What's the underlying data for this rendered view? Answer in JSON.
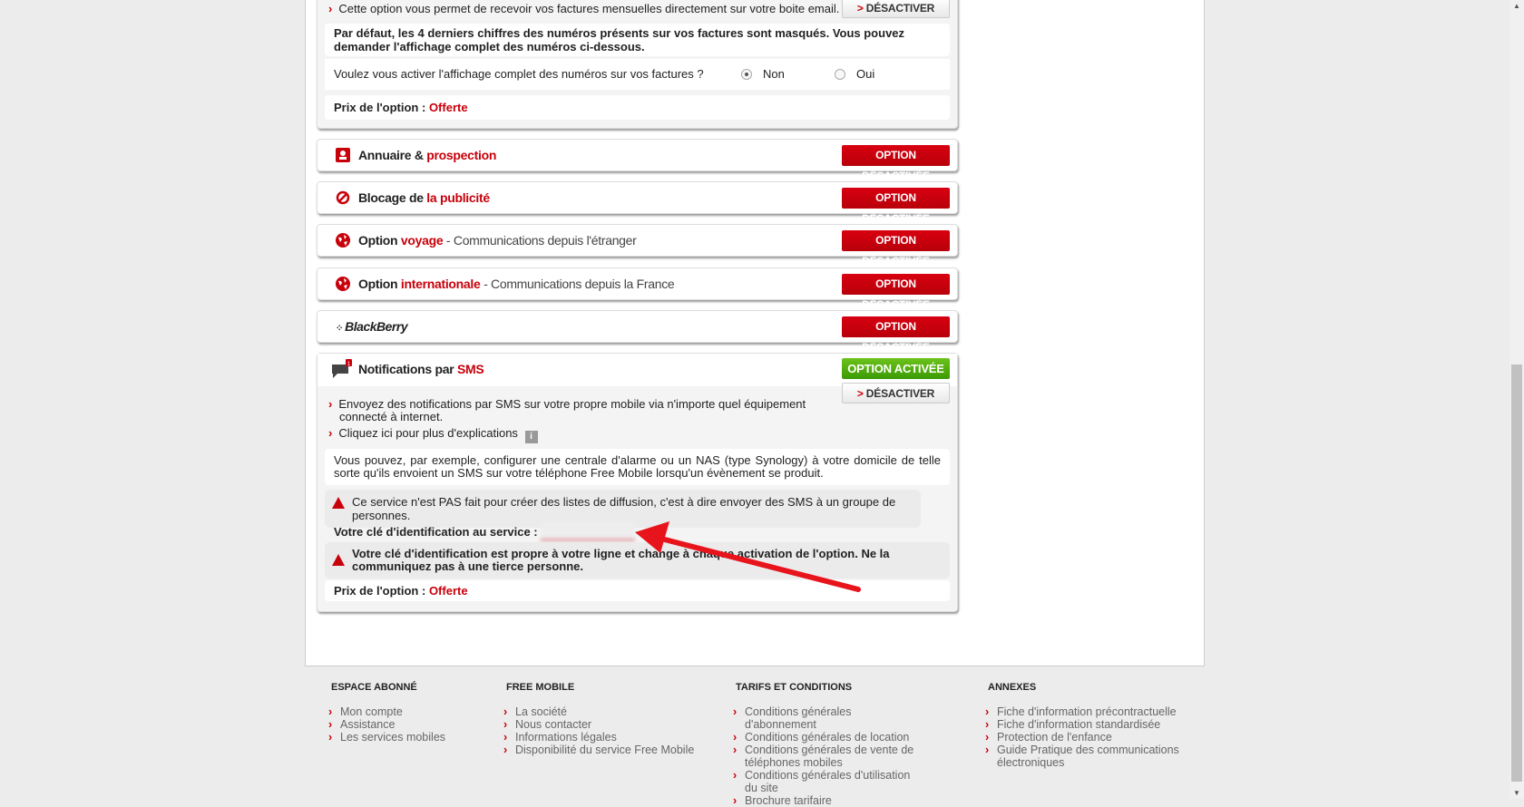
{
  "colors": {
    "accent": "#c8000a",
    "active": "#4caf10"
  },
  "top_card": {
    "bullet": "Cette option vous permet de recevoir vos factures mensuelles directement sur votre boite email.",
    "deactivate": "DÉSACTIVER",
    "note": "Par défaut, les 4 derniers chiffres des numéros présents sur vos factures sont masqués. Vous pouvez demander l'affichage complet des numéros ci-dessous.",
    "question": "Voulez vous activer l'affichage complet des numéros sur vos factures ?",
    "options": [
      {
        "label": "Non",
        "selected": true
      },
      {
        "label": "Oui",
        "selected": false
      }
    ],
    "price_label": "Prix de l'option : ",
    "price": "Offerte"
  },
  "options": [
    {
      "icon": "directory-icon",
      "title": "Annuaire & ",
      "highlight": "prospection",
      "sub": "",
      "status": "OPTION DÉSACTIVÉE"
    },
    {
      "icon": "block-icon",
      "title": "Blocage de ",
      "highlight": "la publicité",
      "sub": "",
      "status": "OPTION DÉSACTIVÉE"
    },
    {
      "icon": "globe-icon",
      "title": "Option ",
      "highlight": "voyage",
      "sub": " - Communications depuis l'étranger",
      "status": "OPTION DÉSACTIVÉE"
    },
    {
      "icon": "globe-icon",
      "title": "Option ",
      "highlight": "internationale",
      "sub": " - Communications depuis la France",
      "status": "OPTION DÉSACTIVÉE"
    },
    {
      "icon": "blackberry-logo",
      "title": "BlackBerry",
      "highlight": "",
      "sub": "",
      "status": "OPTION DÉSACTIVÉE"
    }
  ],
  "sms": {
    "title": "Notifications par ",
    "highlight": "SMS",
    "badge": "1",
    "status": "OPTION ACTIVÉE",
    "deactivate": "DÉSACTIVER",
    "bullets": [
      "Envoyez des notifications par SMS sur votre propre mobile via n'importe quel équipement connecté à internet.",
      "Cliquez ici pour plus d'explications"
    ],
    "example": "Vous pouvez, par exemple, configurer une centrale d'alarme ou un NAS (type Synology) à votre domicile de telle sorte qu'ils envoient un SMS sur votre téléphone Free Mobile lorsqu'un évènement se produit.",
    "warning": "Ce service n'est PAS fait pour créer des listes de diffusion, c'est à dire envoyer des SMS à un groupe de personnes.",
    "key_label": "Votre clé d'identification au service :",
    "key_warning": "Votre clé d'identification est propre à votre ligne et change à chaque activation de l'option. Ne la communiquez pas à une tierce personne.",
    "price_label": "Prix de l'option : ",
    "price": "Offerte"
  },
  "footer": [
    {
      "heading": "ESPACE ABONNÉ",
      "links": [
        "Mon compte",
        "Assistance",
        "Les services mobiles"
      ]
    },
    {
      "heading": "FREE MOBILE",
      "links": [
        "La société",
        "Nous contacter",
        "Informations légales",
        "Disponibilité du service Free Mobile"
      ]
    },
    {
      "heading": "TARIFS ET CONDITIONS",
      "links": [
        "Conditions générales d'abonnement",
        "Conditions générales de location",
        "Conditions générales de vente de téléphones mobiles",
        "Conditions générales d'utilisation du site",
        "Brochure tarifaire"
      ]
    },
    {
      "heading": "ANNEXES",
      "links": [
        "Fiche d'information précontractuelle",
        "Fiche d'information standardisée",
        "Protection de l'enfance",
        "Guide Pratique des communications électroniques"
      ]
    }
  ]
}
